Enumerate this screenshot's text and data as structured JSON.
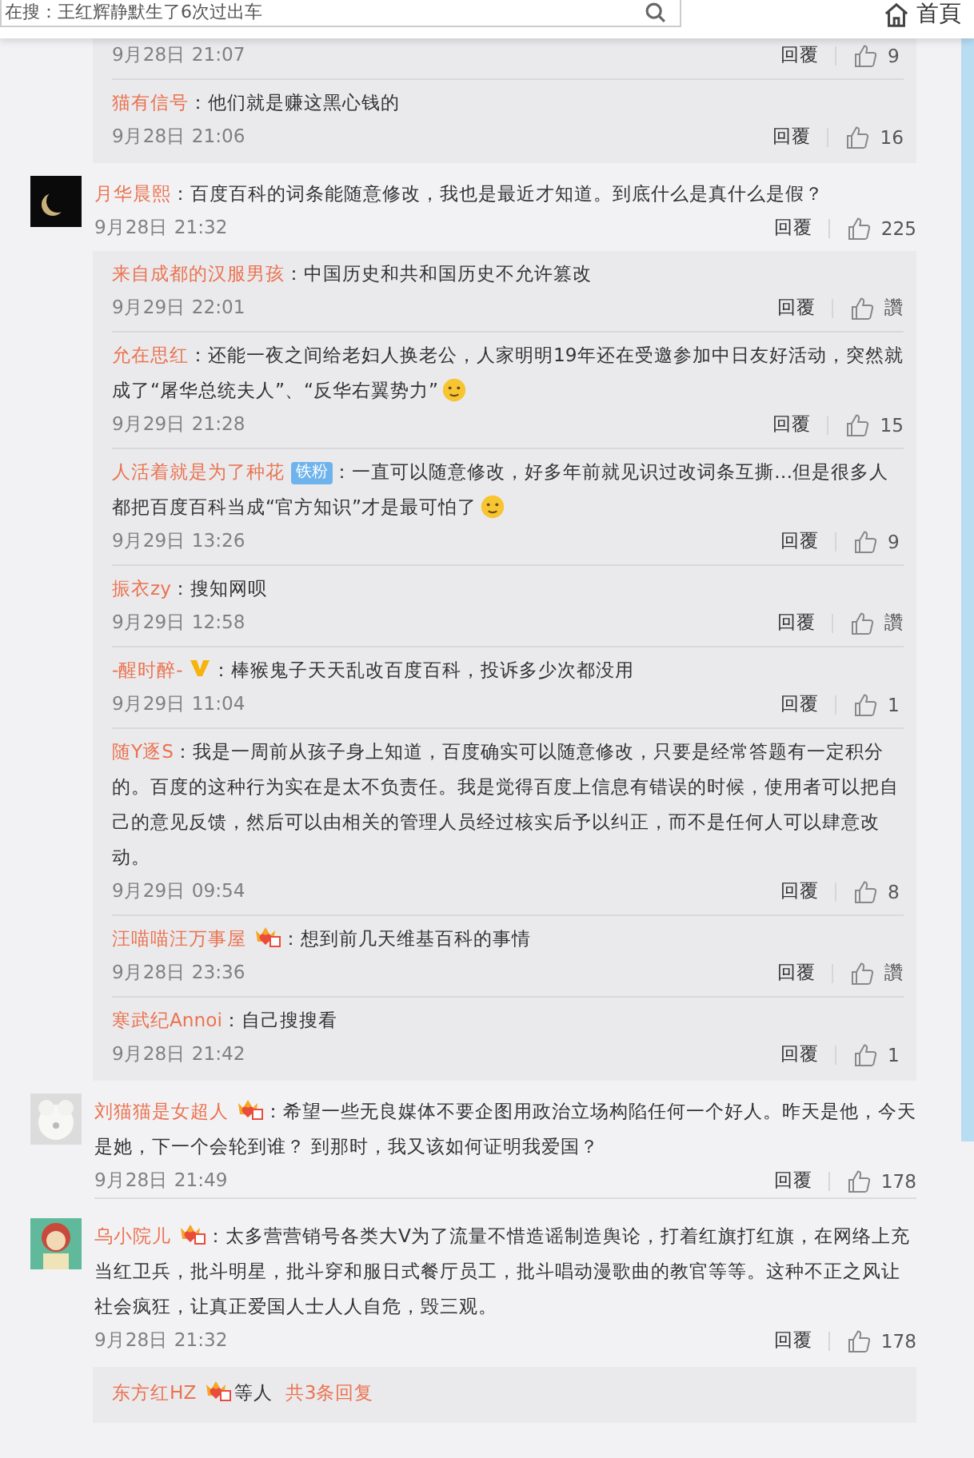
{
  "header": {
    "search_value": "在搜：王红辉静默生了6次过出车",
    "home_label": "首頁"
  },
  "threads": [
    {
      "replies": [
        {
          "date": "9月28日 21:07",
          "reply_label": "回覆",
          "likes": "9"
        },
        {
          "name": "猫有信号",
          "text": "：他们就是赚这黑心钱的",
          "date": "9月28日 21:06",
          "reply_label": "回覆",
          "likes": "16"
        }
      ]
    },
    {
      "comment": {
        "name": "月华晨熙",
        "text": "：百度百科的词条能随意修改，我也是最近才知道。到底什么是真什么是假？",
        "date": "9月28日 21:32",
        "reply_label": "回覆",
        "likes": "225"
      },
      "replies": [
        {
          "name": "来自成都的汉服男孩",
          "text": "：中国历史和共和国历史不允许篡改",
          "date": "9月29日 22:01",
          "reply_label": "回覆",
          "likes": "讚"
        },
        {
          "name": "允在思红",
          "text": "：还能一夜之间给老妇人换老公，人家明明19年还在受邀参加中日友好活动，突然就成了“屠华总统夫人”、“反华右翼势力”",
          "emoji": true,
          "date": "9月29日 21:28",
          "reply_label": "回覆",
          "likes": "15"
        },
        {
          "name": "人活着就是为了种花",
          "badge": {
            "kind": "fan",
            "text": "铁粉"
          },
          "text": "：一直可以随意修改，好多年前就见识过改词条互撕…但是很多人都把百度百科当成“官方知识”才是最可怕了",
          "emoji": true,
          "date": "9月29日 13:26",
          "reply_label": "回覆",
          "likes": "9"
        },
        {
          "name": "振衣zy",
          "text": "：搜知网呗",
          "date": "9月29日 12:58",
          "reply_label": "回覆",
          "likes": "讚"
        },
        {
          "name": "-醒时醉-",
          "badge": {
            "kind": "verified"
          },
          "text": "：棒猴鬼子天天乱改百度百科，投诉多少次都没用",
          "date": "9月29日 11:04",
          "reply_label": "回覆",
          "likes": "1"
        },
        {
          "name": "随Y逐S",
          "text": "：我是一周前从孩子身上知道，百度确实可以随意修改，只要是经常答题有一定积分的。百度的这种行为实在是太不负责任。我是觉得百度上信息有错误的时候，使用者可以把自己的意见反馈，然后可以由相关的管理人员经过核实后予以纠正，而不是任何人可以肆意改动。",
          "date": "9月29日 09:54",
          "reply_label": "回覆",
          "likes": "8"
        },
        {
          "name": "汪喵喵汪万事屋",
          "badge": {
            "kind": "member"
          },
          "text": "：想到前几天维基百科的事情",
          "date": "9月28日 23:36",
          "reply_label": "回覆",
          "likes": "讚"
        },
        {
          "name": "寒武纪Annoi",
          "text": "：自己搜搜看",
          "date": "9月28日 21:42",
          "reply_label": "回覆",
          "likes": "1"
        }
      ]
    },
    {
      "comment": {
        "name": "刘猫猫是女超人",
        "badge": {
          "kind": "member"
        },
        "text": "：希望一些无良媒体不要企图用政治立场构陷任何一个好人。昨天是他，今天是她，下一个会轮到谁？ 到那时，我又该如何证明我爱国？",
        "date": "9月28日 21:49",
        "reply_label": "回覆",
        "likes": "178"
      }
    },
    {
      "comment": {
        "name": "乌小院儿",
        "badge": {
          "kind": "member"
        },
        "text": "：太多营营销号各类大V为了流量不惜造谣制造舆论，打着红旗打红旗，在网络上充当红卫兵，批斗明星，批斗穿和服日式餐厅员工，批斗唱动漫歌曲的教官等等。这种不正之风让社会疯狂，让真正爱国人士人人自危，毁三观。",
        "date": "9月28日 21:32",
        "reply_label": "回覆",
        "likes": "178"
      },
      "summary": {
        "name": "东方红HZ",
        "badge": {
          "kind": "member"
        },
        "middle": "等人",
        "link": "共3条回复"
      }
    }
  ]
}
